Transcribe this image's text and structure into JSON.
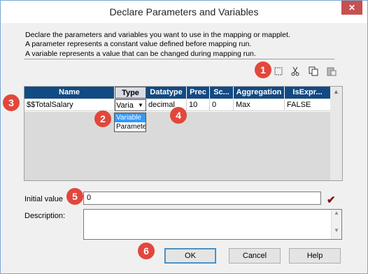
{
  "window": {
    "title": "Declare Parameters and Variables",
    "close_glyph": "✕"
  },
  "description": {
    "line1": "Declare the parameters and variables you want to use in the mapping or mapplet.",
    "line2": "A parameter represents a constant value defined before mapping run.",
    "line3": "A variable represents a value that can be changed during mapping run."
  },
  "toolbar": {
    "icons": [
      "new-icon",
      "cut-icon",
      "copy-icon",
      "paste-icon"
    ]
  },
  "grid": {
    "headers": [
      "Name",
      "Type",
      "Datatype",
      "Prec",
      "Sc...",
      "Aggregation",
      "IsExpr..."
    ],
    "rows": [
      {
        "name": "$$TotalSalary",
        "type": "Varia",
        "datatype": "decimal",
        "prec": "10",
        "scale": "0",
        "aggregation": "Max",
        "isexpr": "FALSE"
      }
    ],
    "type_options": [
      "Variable",
      "Paramete"
    ]
  },
  "initial_value": {
    "label": "Initial value",
    "value": "0"
  },
  "description_field": {
    "label": "Description:",
    "value": ""
  },
  "buttons": {
    "ok": "OK",
    "cancel": "Cancel",
    "help": "Help"
  },
  "callouts": [
    "1",
    "2",
    "3",
    "4",
    "5",
    "6"
  ]
}
